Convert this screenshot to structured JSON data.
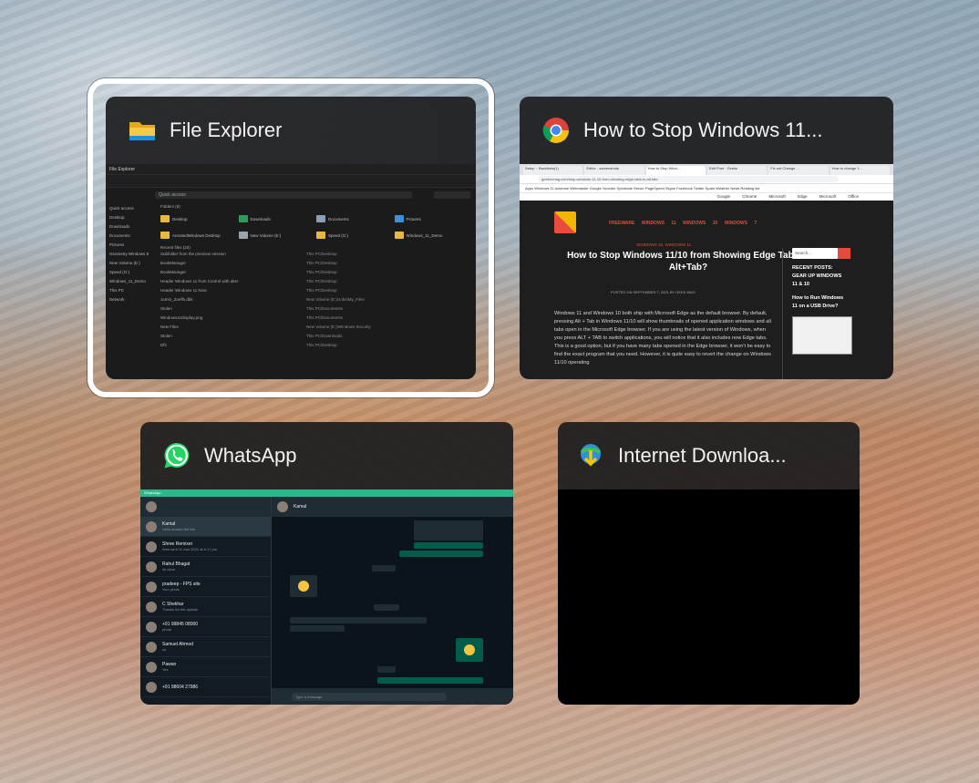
{
  "windows": [
    {
      "title": "File Explorer",
      "icon": "folder-icon",
      "selected": true
    },
    {
      "title": "How to Stop Windows 11...",
      "icon": "chrome-icon",
      "selected": false
    },
    {
      "title": "WhatsApp",
      "icon": "whatsapp-icon",
      "selected": false
    },
    {
      "title": "Internet Downloa...",
      "icon": "idm-icon",
      "selected": false
    }
  ],
  "file_explorer": {
    "titlebar": "File Explorer",
    "address": "Quick access",
    "section_folders": "Folders (8)",
    "section_recent": "Recent files (20)",
    "sidebar": [
      "Quick access",
      "Desktop",
      "Downloads",
      "Documents",
      "Pictures",
      "Geometry Windows 8",
      "New Volume (E:)",
      "Speed (G:)",
      "Windows_11_Demo",
      "This PC",
      "Network"
    ],
    "folders": [
      "Desktop",
      "Downloads",
      "Documents",
      "Pictures",
      "AnnotedWindows Desktop",
      "New Volume (E:)",
      "Speed (G:)",
      "Windows_11_Demo"
    ],
    "recent": [
      {
        "name": "Subfolder from the previous session",
        "loc": "This PC\\Desktop"
      },
      {
        "name": "BookManager",
        "loc": "This PC\\Desktop"
      },
      {
        "name": "BookManager",
        "loc": "This PC\\Desktop"
      },
      {
        "name": "Header Windows 11 from Control with alter",
        "loc": "This PC\\Desktop"
      },
      {
        "name": "Header Windows 11 Now",
        "loc": "This PC\\Desktop"
      },
      {
        "name": "Jomm_Zoeffs.dbk",
        "loc": "New Volume (E:)\\Jobs\\My_Files"
      },
      {
        "name": "Stolen",
        "loc": "This PC\\Documents"
      },
      {
        "name": "Windows11Display.png",
        "loc": "This PC\\Documents"
      },
      {
        "name": "New Files",
        "loc": "New Volume (E:)\\Windows Security"
      },
      {
        "name": "Stolen",
        "loc": "This PC\\Downloads"
      },
      {
        "name": "Dfs",
        "loc": "This PC\\Desktop"
      }
    ]
  },
  "chrome": {
    "tabs": [
      "Setup ~ Backlinks(1)",
      "Editor - screenshots",
      "How to Stop Wind...",
      "Edit Post · Geeks",
      "Fix not Change ...",
      "How to change 1..."
    ],
    "url": "geekermag.com/stop-windows-11-10-from-showing-edge-tabs-in-alt-tab/",
    "bookmarks": "Apps  Windows 11  Adsense  Webmaster  Google  Youtube  Syndicate  Server  PageSpeed  Skype  Facebook  Twitter  Spam  Weather  News  Reading list",
    "topstrip": "Google Chrome  Microsoft Edge  Microsoft Office",
    "site_nav": "FREEWARE  WINDOWS 11  WINDOWS 10  WINDOWS 7",
    "category": "WINDOWS 10, WINDOWS 11",
    "article_title": "How to Stop Windows 11/10 from Showing Edge Tabs in Alt+Tab?",
    "meta": "POSTED ON SEPTEMBER 7, 2021 BY GEEK MAG",
    "body": "Windows 11 and Windows 10 both ship with Microsoft Edge as the default browser. By default, pressing Alt + Tab in Windows 11/10 will show thumbnails of opened application windows and all tabs open in the Microsoft Edge browser. If you are using the latest version of Windows, when you press ALT + TAB to switch applications, you will notice that it also includes now Edge tabs. This is a good option, but if you have many tabs opened in the Edge browser, it won't be easy to find the exact program that you need. However, it is quite easy to revert the change on Windows 11/10 operating",
    "search_placeholder": "Search...",
    "sidebar_heading": "RECENT POSTS: GEAR UP WINDOWS 11 & 10",
    "sidebar_post": "How to Run Windows 11 on a USB Drive?"
  },
  "whatsapp": {
    "topbar": "WhatsApp",
    "chat_name": "Kamal",
    "chats": [
      {
        "name": "Kamal",
        "msg": "Hello shared the link"
      },
      {
        "name": "Shree Remixer",
        "msg": "Wed sent 11 mar 2021 at 6:17 pm"
      },
      {
        "name": "Rahul Bhagat",
        "msg": "ok done"
      },
      {
        "name": "pradeep - FPS site",
        "msg": "You: photo"
      },
      {
        "name": "C Shekhar",
        "msg": "Thanks for the update"
      },
      {
        "name": "+91 99845 08000",
        "msg": "photo"
      },
      {
        "name": "Samuel Ahmed",
        "msg": "ok"
      },
      {
        "name": "Pawan",
        "msg": "Yes"
      },
      {
        "name": "+91 98604 27986",
        "msg": ""
      }
    ],
    "input_placeholder": "Type a message"
  },
  "idm": {
    "preview": ""
  }
}
